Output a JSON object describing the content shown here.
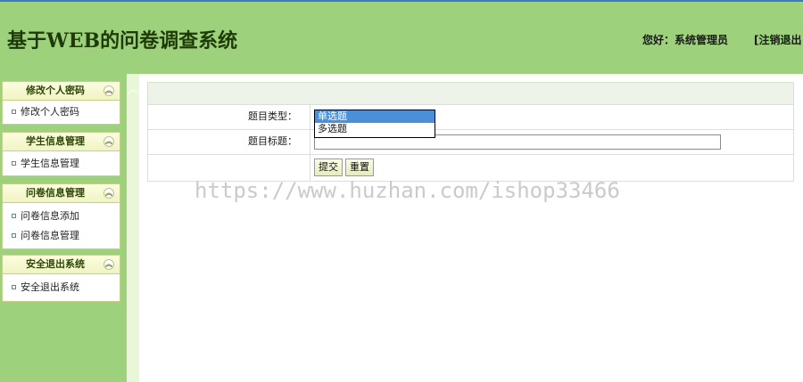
{
  "header": {
    "title": "基于WEB的问卷调查系统",
    "greeting": "您好：系统管理员",
    "logout_label": "[注销退出"
  },
  "sidebar": {
    "groups": [
      {
        "title": "修改个人密码",
        "items": [
          "修改个人密码"
        ]
      },
      {
        "title": "学生信息管理",
        "items": [
          "学生信息管理"
        ]
      },
      {
        "title": "问卷信息管理",
        "items": [
          "问卷信息添加",
          "问卷信息管理"
        ]
      },
      {
        "title": "安全退出系统",
        "items": [
          "安全退出系统"
        ]
      }
    ],
    "collapse_glyph": "⌃⌃",
    "splitter_glyph": "︿"
  },
  "form": {
    "type_label": "题目类型：",
    "type_options": [
      "单选题",
      "多选题"
    ],
    "type_selected": "单选题",
    "title_label": "题目标题：",
    "title_value": "",
    "submit_label": "提交",
    "reset_label": "重置"
  },
  "watermark": "https://www.huzhan.com/ishop33466",
  "colors": {
    "header_bg": "#9dd17b",
    "top_line": "#3c7ac1",
    "menu_title_bg": "#f1f4c2",
    "selected_option_bg": "#4a8fd8"
  }
}
